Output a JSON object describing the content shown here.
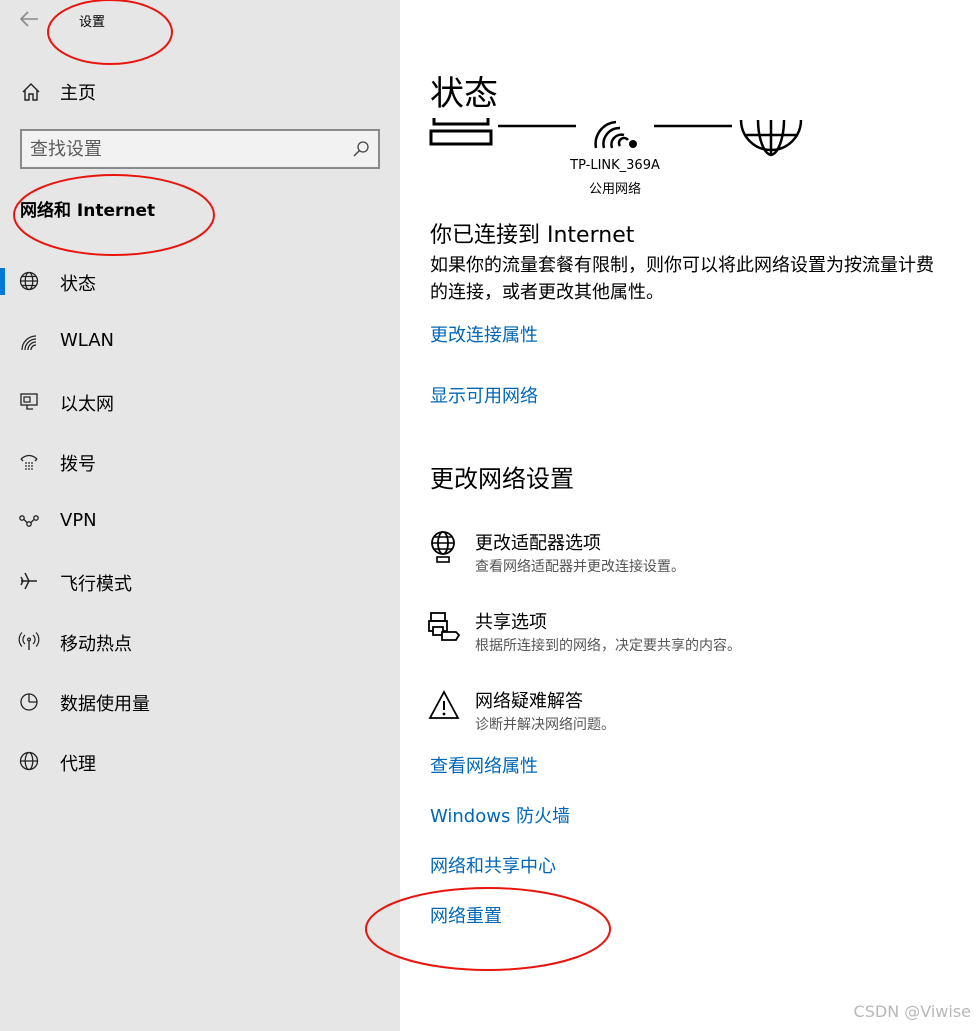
{
  "sidebar": {
    "app_title": "设置",
    "home_label": "主页",
    "search_placeholder": "查找设置",
    "section_heading": "网络和 Internet",
    "items": [
      {
        "label": "状态",
        "icon": "globe-icon",
        "selected": true
      },
      {
        "label": "WLAN",
        "icon": "wifi-icon",
        "selected": false
      },
      {
        "label": "以太网",
        "icon": "ethernet-icon",
        "selected": false
      },
      {
        "label": "拨号",
        "icon": "dialup-icon",
        "selected": false
      },
      {
        "label": "VPN",
        "icon": "vpn-icon",
        "selected": false
      },
      {
        "label": "飞行模式",
        "icon": "airplane-icon",
        "selected": false
      },
      {
        "label": "移动热点",
        "icon": "hotspot-icon",
        "selected": false
      },
      {
        "label": "数据使用量",
        "icon": "data-usage-icon",
        "selected": false
      },
      {
        "label": "代理",
        "icon": "proxy-globe-icon",
        "selected": false
      }
    ]
  },
  "main": {
    "title": "状态",
    "network": {
      "ssid": "TP-LINK_369A",
      "type": "公用网络"
    },
    "connected_heading": "你已连接到 Internet",
    "connected_desc": "如果你的流量套餐有限制，则你可以将此网络设置为按流量计费的连接，或者更改其他属性。",
    "link_change_props": "更改连接属性",
    "link_show_networks": "显示可用网络",
    "change_heading": "更改网络设置",
    "options": [
      {
        "title": "更改适配器选项",
        "desc": "查看网络适配器并更改连接设置。",
        "icon": "adapter-globe-icon"
      },
      {
        "title": "共享选项",
        "desc": "根据所连接到的网络，决定要共享的内容。",
        "icon": "sharing-printer-icon"
      },
      {
        "title": "网络疑难解答",
        "desc": "诊断并解决网络问题。",
        "icon": "warning-icon"
      }
    ],
    "links": [
      "查看网络属性",
      "Windows 防火墙",
      "网络和共享中心",
      "网络重置"
    ]
  },
  "watermark": "CSDN @Viwise",
  "colors": {
    "accent": "#0078d7",
    "link": "#0067b8",
    "sidebar_bg": "#e6e6e6",
    "annotation": "#e8150f"
  }
}
